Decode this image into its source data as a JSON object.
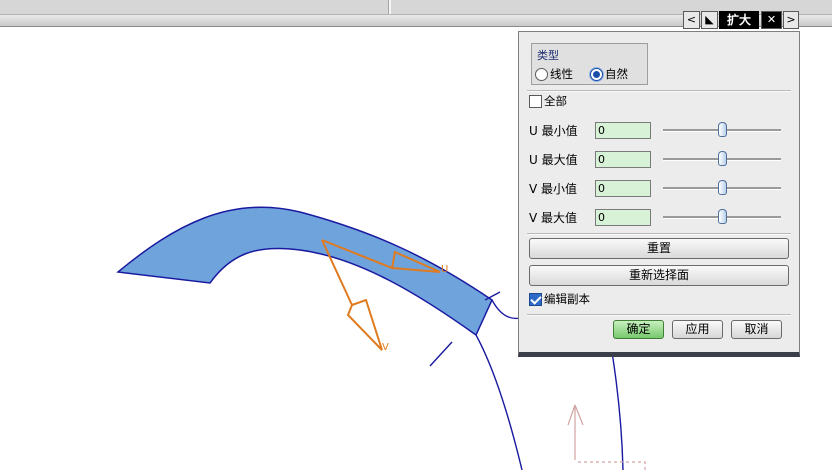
{
  "dialog": {
    "title": "扩大",
    "prev_label": "<",
    "next_label": ">",
    "close_label": "✕",
    "type_group": {
      "title": "类型",
      "options": [
        "线性",
        "自然"
      ],
      "selected": "自然"
    },
    "all_checkbox": {
      "label": "全部",
      "checked": false
    },
    "params": [
      {
        "label": "U 最小值",
        "value": "0",
        "slider": 0.5
      },
      {
        "label": "U 最大值",
        "value": "0",
        "slider": 0.5
      },
      {
        "label": "V 最小值",
        "value": "0",
        "slider": 0.5
      },
      {
        "label": "V 最大值",
        "value": "0",
        "slider": 0.5
      }
    ],
    "reset_label": "重置",
    "reselect_label": "重新选择面",
    "edit_copy": {
      "label": "编辑副本",
      "checked": true
    },
    "ok_label": "确定",
    "apply_label": "应用",
    "cancel_label": "取消"
  },
  "viewport": {
    "u_axis_label": "U",
    "v_axis_label": "V",
    "face_color": "#6fa3dc",
    "curve_color": "#1a1aa0",
    "vector_color": "#e07a1f"
  }
}
